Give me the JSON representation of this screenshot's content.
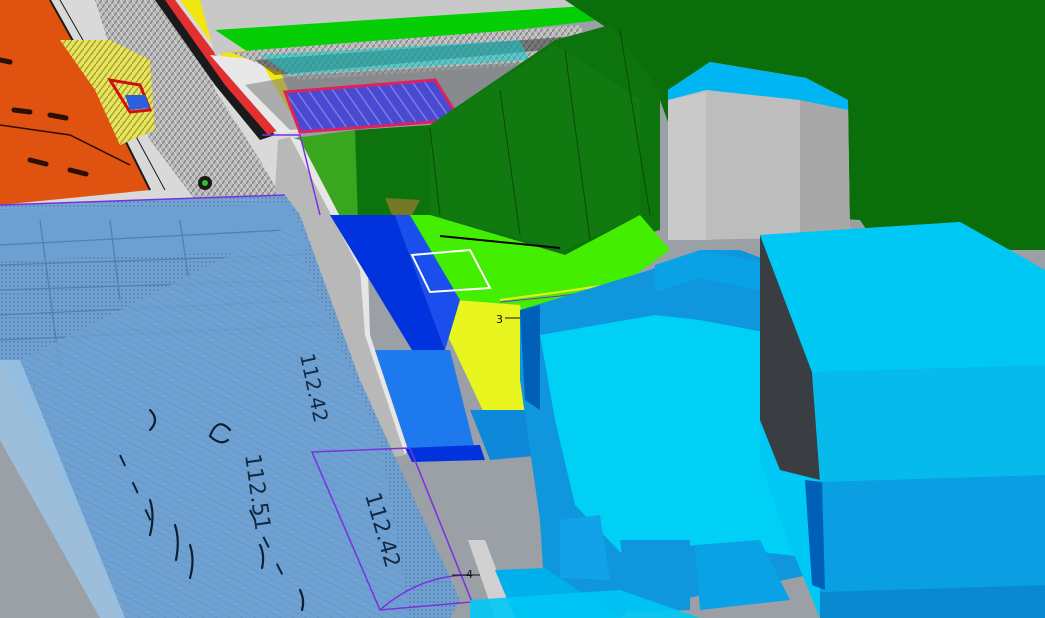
{
  "viewport": {
    "markers": {
      "point_3": "3",
      "point_4": "4"
    },
    "plan_dimensions": {
      "level_upper": "112.42",
      "level_middle": "112.51",
      "level_lower": "112.42"
    }
  },
  "colors": {
    "terrain_green_dark": "#0a6e0a",
    "terrain_green_mid": "#1e8c14",
    "grass_bright": "#44ee00",
    "ramp_yellow": "#e8f51f",
    "water_blue": "#0033dd",
    "mid_blue": "#1e78ee",
    "building_cyan": "#00c8f5",
    "building_top": "#00d4f8",
    "building_wall": "#0090d8",
    "building_dark_wall": "#3a3d42",
    "tower_grey": "#bdbdbd",
    "plan_overlay": "#6fa4d8",
    "orange_plot": "#e05210",
    "selection_purple": "#7a30e0"
  }
}
